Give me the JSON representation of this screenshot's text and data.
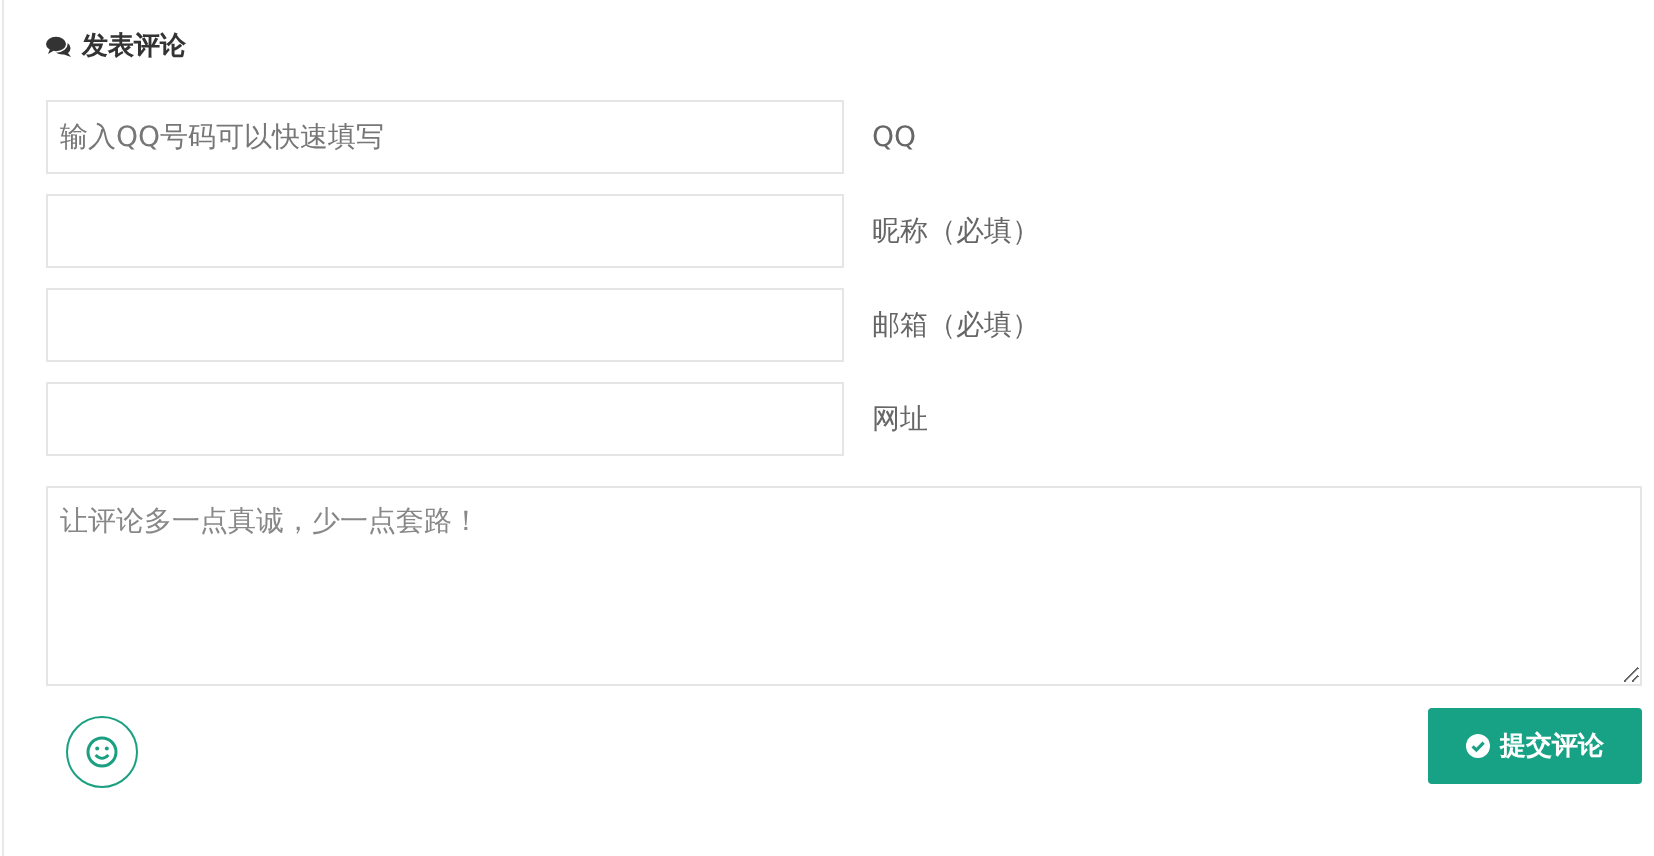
{
  "heading": "发表评论",
  "fields": [
    {
      "placeholder": "输入QQ号码可以快速填写",
      "label": "QQ"
    },
    {
      "label": "昵称（必填）"
    },
    {
      "label": "邮箱（必填）"
    },
    {
      "label": "网址"
    }
  ],
  "comment": {
    "placeholder": "让评论多一点真诚，少一点套路！"
  },
  "submit_button": "提交评论"
}
